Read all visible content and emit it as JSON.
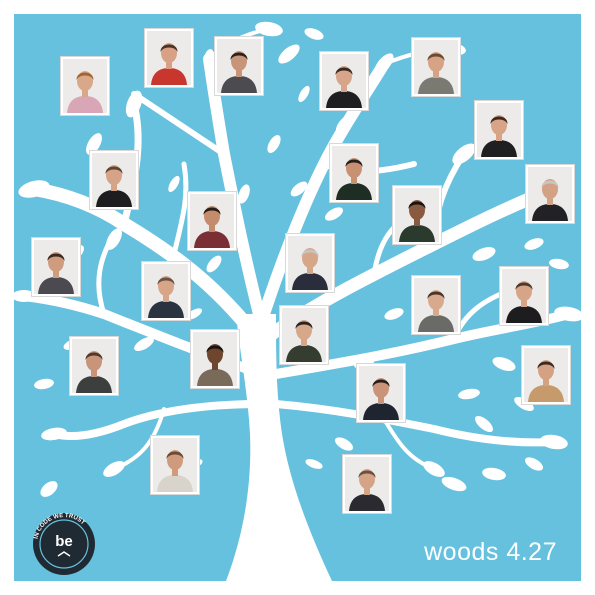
{
  "caption": "woods 4.27",
  "logo": {
    "ring_text": "IN CODE WE TRUST",
    "mark": "be"
  },
  "colors": {
    "background": "#66c1de",
    "tree": "#ffffff",
    "frame": "#ffffff"
  },
  "people": [
    {
      "name": "person-photo-1",
      "skin": "#d9a88a",
      "hair": "#a0662e",
      "top": "#d9a6b8"
    },
    {
      "name": "person-photo-2",
      "skin": "#d8a185",
      "hair": "#4a3426",
      "top": "#c8362e"
    },
    {
      "name": "person-photo-3",
      "skin": "#c99578",
      "hair": "#2a2220",
      "top": "#4b4b50"
    },
    {
      "name": "person-photo-4",
      "skin": "#d6a58a",
      "hair": "#3a2a22",
      "top": "#1f1f22"
    },
    {
      "name": "person-photo-5",
      "skin": "#d7a386",
      "hair": "#6a4a30",
      "top": "#7a7a72"
    },
    {
      "name": "person-photo-6",
      "skin": "#d8a488",
      "hair": "#3a2a20",
      "top": "#1f1f22"
    },
    {
      "name": "person-photo-7",
      "skin": "#d5a488",
      "hair": "#5b4634",
      "top": "#1d1d20"
    },
    {
      "name": "person-photo-8",
      "skin": "#c79172",
      "hair": "#2a1f1a",
      "top": "#1f2e24"
    },
    {
      "name": "person-photo-9",
      "skin": "#d3a184",
      "hair": "#c9c6c0",
      "top": "#222226"
    },
    {
      "name": "person-photo-10",
      "skin": "#c48c6a",
      "hair": "#2a1f18",
      "top": "#7a2f35"
    },
    {
      "name": "person-photo-11",
      "skin": "#8a5a40",
      "hair": "#1a1410",
      "top": "#2a3a2c"
    },
    {
      "name": "person-photo-12",
      "skin": "#cf9c7f",
      "hair": "#3a2a20",
      "top": "#4a4a50"
    },
    {
      "name": "person-photo-13",
      "skin": "#d6a689",
      "hair": "#c9c3bc",
      "top": "#2a2e3c"
    },
    {
      "name": "person-photo-14",
      "skin": "#d7a588",
      "hair": "#6a5244",
      "top": "#2a3440"
    },
    {
      "name": "person-photo-15",
      "skin": "#d8a98c",
      "hair": "#4a3428",
      "top": "#6a6a66"
    },
    {
      "name": "person-photo-16",
      "skin": "#d6a487",
      "hair": "#4a3a2c",
      "top": "#1d1d20"
    },
    {
      "name": "person-photo-17",
      "skin": "#c8957a",
      "hair": "#4a3a30",
      "top": "#3c3f3e"
    },
    {
      "name": "person-photo-18",
      "skin": "#d7a78a",
      "hair": "#2a2420",
      "top": "#343d30"
    },
    {
      "name": "person-photo-19",
      "skin": "#6e4630",
      "hair": "#1a1410",
      "top": "#7a6a5a"
    },
    {
      "name": "person-photo-20",
      "skin": "#d4a283",
      "hair": "#3a2a20",
      "top": "#c69a6a"
    },
    {
      "name": "person-photo-21",
      "skin": "#c9947a",
      "hair": "#2a1f18",
      "top": "#1f2530"
    },
    {
      "name": "person-photo-22",
      "skin": "#cf9b7c",
      "hair": "#6a4a34",
      "top": "#d8d4cc"
    },
    {
      "name": "person-photo-23",
      "skin": "#d5a386",
      "hair": "#6a5042",
      "top": "#2a2a30"
    }
  ]
}
